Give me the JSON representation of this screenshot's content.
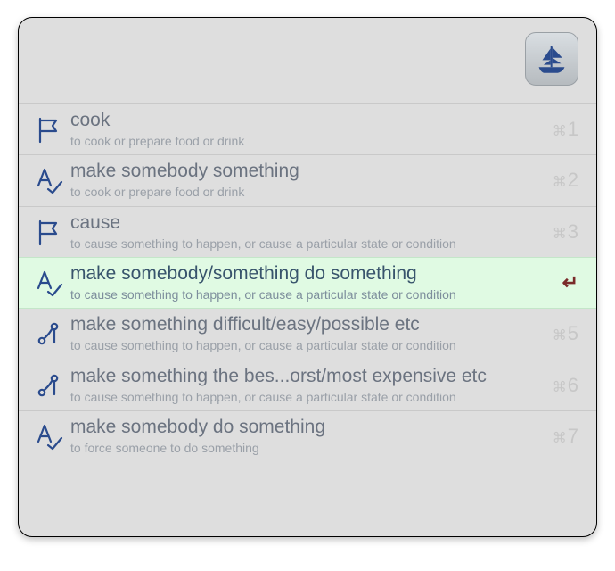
{
  "appIconName": "ship-icon",
  "shortcutPrefix": "⌘",
  "enterGlyph": "↵",
  "rows": [
    {
      "icon": "flag",
      "title": "cook",
      "sub": "to cook or prepare food or drink",
      "shortcut": "1",
      "selected": false
    },
    {
      "icon": "acheck",
      "title": "make somebody something",
      "sub": "to cook or prepare food or drink",
      "shortcut": "2",
      "selected": false
    },
    {
      "icon": "flag",
      "title": "cause",
      "sub": "to cause something to happen, or cause a particular state or condition",
      "shortcut": "3",
      "selected": false
    },
    {
      "icon": "acheck",
      "title": "make somebody/something do something",
      "sub": "to cause something to happen, or cause a particular state or condition",
      "shortcut": "4",
      "selected": true
    },
    {
      "icon": "branch",
      "title": "make something difficult/easy/possible etc",
      "sub": "to cause something to happen, or cause a particular state or condition",
      "shortcut": "5",
      "selected": false
    },
    {
      "icon": "branch",
      "title": "make something the bes...orst/most expensive etc",
      "sub": "to cause something to happen, or cause a particular state or condition",
      "shortcut": "6",
      "selected": false
    },
    {
      "icon": "acheck",
      "title": "make somebody do something",
      "sub": "to force someone to do something",
      "shortcut": "7",
      "selected": false
    }
  ]
}
